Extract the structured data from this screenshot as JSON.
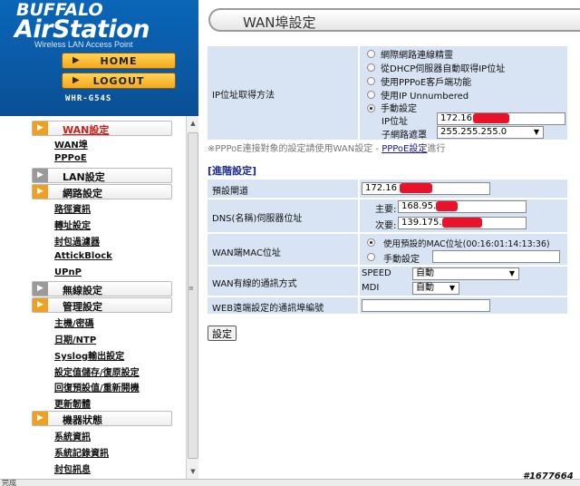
{
  "brand": {
    "company": "BUFFALO",
    "product": "AirStation",
    "tagline": "Wireless LAN Access Point",
    "model": "WHR-G54S"
  },
  "nav": {
    "home": "HOME",
    "logout": "LOGOUT"
  },
  "menu": {
    "sections": [
      {
        "label": "WAN設定",
        "items": [
          "WAN埠",
          "PPPoE"
        ]
      },
      {
        "label": "LAN設定",
        "items": []
      },
      {
        "label": "網路設定",
        "items": [
          "路徑資訊",
          "轉址設定",
          "封包過濾器",
          "AttickBlock",
          "UPnP"
        ]
      },
      {
        "label": "無線設定",
        "items": []
      },
      {
        "label": "管理設定",
        "items": [
          "主機/密碼",
          "日期/NTP",
          "Syslog輸出設定",
          "設定值儲存/復原設定",
          "回復預設值/重新開機",
          "更新韌體"
        ]
      },
      {
        "label": "機器狀態",
        "items": [
          "系統資訊",
          "系統記錄資訊",
          "封包訊息"
        ]
      }
    ]
  },
  "page": {
    "title": "WAN埠設定",
    "ip_method": {
      "label": "IP位址取得方法",
      "options": [
        "網際網路連線精靈",
        "從DHCP伺服器自動取得IP位址",
        "使用PPPoE客戶端功能",
        "使用IP Unnumbered",
        "手動設定"
      ],
      "selected_index": 4,
      "ip_label": "IP位址",
      "ip_value": "172.16",
      "mask_label": "子網路遮罩",
      "mask_value": "255.255.255.0"
    },
    "pppoe_note_prefix": "※PPPoE連接對象的設定請使用WAN設定 - ",
    "pppoe_note_link": "PPPoE設定",
    "pppoe_note_suffix": "進行",
    "advanced_heading": "[進階設定]",
    "gateway": {
      "label": "預設閘道",
      "value": "172.16"
    },
    "dns": {
      "label": "DNS(名稱)伺服器位址",
      "primary_label": "主要:",
      "primary_value": "168.95.",
      "secondary_label": "次要:",
      "secondary_value": "139.175."
    },
    "mac": {
      "label": "WAN端MAC位址",
      "default_option": "使用預設的MAC位址(00:16:01:14:13:36)",
      "manual_option": "手動設定",
      "selected": "default"
    },
    "link": {
      "label": "WAN有線的通訊方式",
      "speed_label": "SPEED",
      "speed_value": "自動",
      "mdi_label": "MDI",
      "mdi_value": "自動"
    },
    "web_port": {
      "label": "WEB遠端設定的通訊埠編號",
      "value": ""
    },
    "apply_label": "設定"
  },
  "status_bar": {
    "text": "完成"
  },
  "watermark": "#1677664",
  "colors": {
    "banner": "#0b5aa6",
    "label_cell": "#d8e4f4",
    "section_icon": "#f0a020",
    "redaction": "#e8132a"
  }
}
